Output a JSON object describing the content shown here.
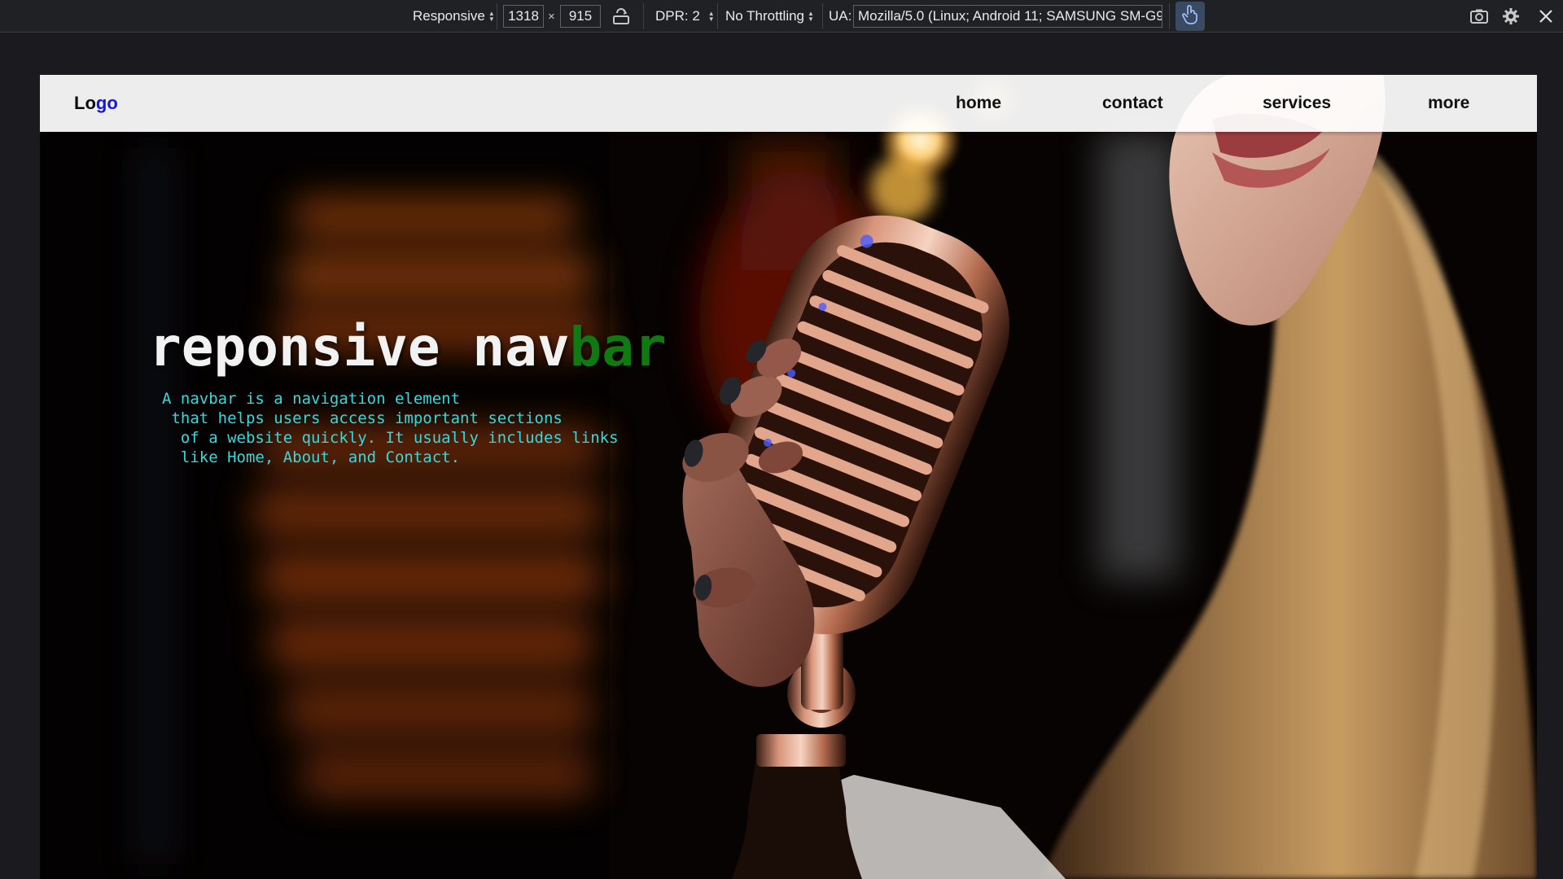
{
  "devtools": {
    "device_mode": "Responsive",
    "width": "1318",
    "times": "×",
    "height": "915",
    "dpr": "DPR: 2",
    "throttling": "No Throttling",
    "ua_label": "UA:",
    "ua_value": "Mozilla/5.0 (Linux; Android 11; SAMSUNG SM-G97"
  },
  "site": {
    "logo_part1": "Lo",
    "logo_part2": "go",
    "nav": [
      "home",
      "contact",
      "services",
      "more"
    ],
    "hero": {
      "title_main": "reponsive nav",
      "title_accent": "bar",
      "description_lines": [
        "A navbar is a navigation element",
        " that helps users access important sections",
        "  of a website quickly. It usually includes links",
        "  like Home, About, and Contact."
      ]
    }
  },
  "colors": {
    "logo_accent": "#1515d8",
    "title_accent": "#0f7a0f",
    "description": "#37d8dd",
    "toolbar_bg": "#202124",
    "touch_active": "#3a4a63"
  },
  "icons": [
    "rotate-icon",
    "touch-icon",
    "screenshot-icon",
    "gear-icon",
    "close-icon"
  ]
}
